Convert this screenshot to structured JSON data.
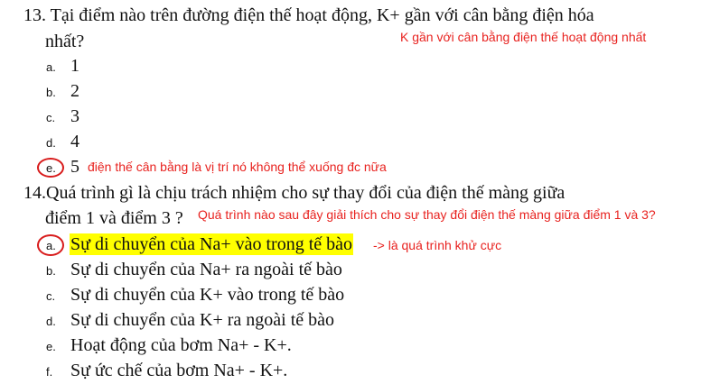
{
  "q13": {
    "line1": "13. Tại điểm nào trên đường điện thế hoạt động, K+ gần với cân bằng điện hóa",
    "line2": "nhất?",
    "note": "K gần với cân bằng điện thế hoạt động nhất",
    "options": [
      {
        "letter": "a.",
        "text": "1"
      },
      {
        "letter": "b.",
        "text": "2"
      },
      {
        "letter": "c.",
        "text": "3"
      },
      {
        "letter": "d.",
        "text": "4"
      },
      {
        "letter": "e.",
        "text": "5",
        "note": "điện thế cân bằng là vị trí nó không thể xuống đc nữa"
      }
    ]
  },
  "q14": {
    "line1": "14.Quá trình gì là chịu trách nhiệm cho sự thay đổi của điện thế màng giữa",
    "line2": "điểm 1 và điểm 3 ?",
    "note": "Quá trình nào sau đây giải thích cho sự thay đổi điện thế màng giữa điểm 1 và 3?",
    "options": [
      {
        "letter": "a.",
        "text": "Sự di chuyển của Na+ vào trong tế bào",
        "note": "-> là quá trình khử cực"
      },
      {
        "letter": "b.",
        "text": "Sự di chuyển của Na+ ra ngoài tế bào"
      },
      {
        "letter": "c.",
        "text": "Sự di chuyển của K+ vào trong tế bào"
      },
      {
        "letter": "d.",
        "text": "Sự di chuyển của K+ ra ngoài tế bào"
      },
      {
        "letter": "e.",
        "text": "Hoạt động của bơm Na+ - K+."
      },
      {
        "letter": "f.",
        "text": "Sự ức chế của bơm Na+ - K+."
      }
    ]
  },
  "colors": {
    "note": "#e8221f",
    "circle": "#d81b1b",
    "highlight": "#ffff00"
  }
}
